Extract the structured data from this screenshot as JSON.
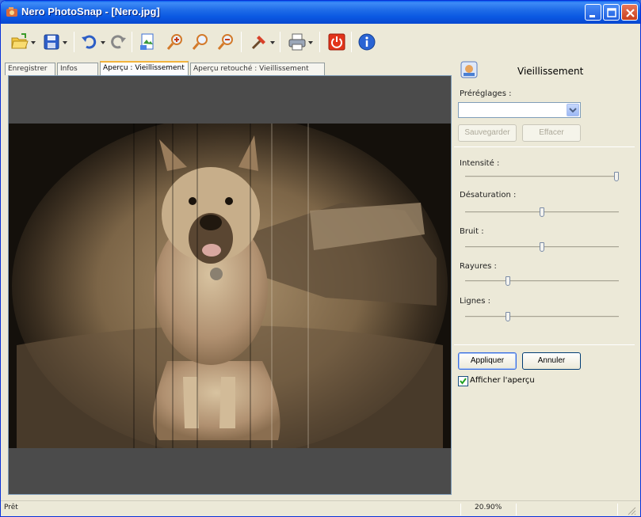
{
  "window": {
    "title": "Nero PhotoSnap - [Nero.jpg]",
    "title_bar_color": "#0a58e2",
    "buttons": [
      "minimize-icon",
      "maximize-icon",
      "close-icon"
    ]
  },
  "toolbar": {
    "items": [
      "open-folder-icon",
      "save-icon",
      "undo-icon",
      "redo-icon",
      "crop-icon",
      "zoom-in-icon",
      "zoom-fit-icon",
      "zoom-out-icon",
      "tools-icon",
      "print-icon",
      "power-icon",
      "info-icon"
    ]
  },
  "tabs": [
    {
      "label": "Enregistrer"
    },
    {
      "label": "Infos"
    },
    {
      "label": "Aperçu : Vieillissement",
      "active": true
    },
    {
      "label": "Aperçu retouché : Vieillissement"
    }
  ],
  "panel": {
    "title": "Vieillissement",
    "presets_label": "Préréglages :",
    "presets_value": "",
    "save_label": "Sauvegarder",
    "delete_label": "Effacer",
    "sliders": [
      {
        "label": "Intensité :",
        "value": 100
      },
      {
        "label": "Désaturation :",
        "value": 50
      },
      {
        "label": "Bruit :",
        "value": 50
      },
      {
        "label": "Rayures :",
        "value": 27
      },
      {
        "label": "Lignes :",
        "value": 27
      }
    ],
    "apply_label": "Appliquer",
    "cancel_label": "Annuler",
    "show_preview_label": "Afficher l'aperçu",
    "show_preview_checked": true
  },
  "status": {
    "left": "Prêt",
    "zoom": "20.90%"
  },
  "colors": {
    "accent": "#0a58e2",
    "tab_highlight": "#f3b33d",
    "sepia": "#a88e6a"
  }
}
